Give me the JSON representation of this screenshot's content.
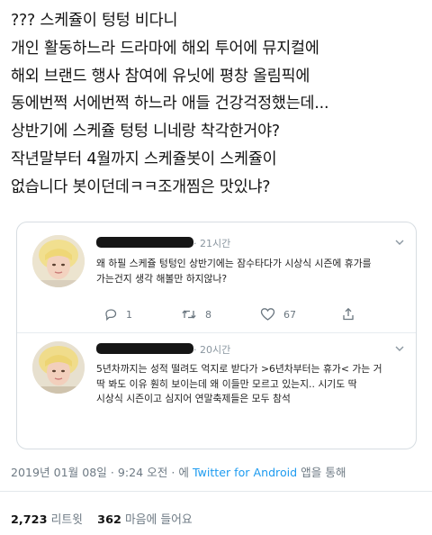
{
  "tweet": {
    "lines": [
      "??? 스케쥴이 텅텅 비다니",
      "개인 활동하느라 드라마에 해외 투어에 뮤지컬에",
      "해외 브랜드 행사 참여에 유닛에 평창 올림픽에",
      "동에번쩍 서에번쩍 하느라 애들 건강걱정했는데...",
      "상반기에 스케쥴 텅텅 니네랑 착각한거야?",
      "작년말부터 4월까지 스케쥴봇이 스케쥴이",
      "없습니다 봇이던데ㅋㅋ조개찜은 맛있냐?"
    ]
  },
  "replies": [
    {
      "time": "· 21시간",
      "lines": [
        "왜 하필 스케쥴 텅텅인 상반기에는 잠수타다가 시상식 시즌에 휴가를",
        "가는건지 생각 해볼만 하지않나?"
      ],
      "counts": {
        "reply": "1",
        "retweet": "8",
        "like": "67"
      }
    },
    {
      "time": "· 20시간",
      "lines": [
        "5년차까지는 성적 떨려도 억지로 받다가 >6년차부터는 휴가< 가는 거",
        "딱 봐도 이유 훤히 보이는데 왜 이들만 모르고 있는지.. 시기도 딱",
        "시상식 시즌이고 심지어 연말축제들은 모두 참석"
      ]
    }
  ],
  "meta": {
    "datetime": "2019년 01월 08일 · 9:24 오전 · 에 ",
    "source": "Twitter for Android",
    "via": " 앱을 통해"
  },
  "stats": {
    "retweets": "2,723",
    "retweets_label": "리트윗",
    "likes": "362",
    "likes_label": "마음에 들어요"
  },
  "colors": {
    "link": "#1d9bf0",
    "muted": "#6e7a84",
    "border": "#d7dde2"
  },
  "icons": [
    "reply-icon",
    "retweet-icon",
    "heart-icon",
    "share-icon",
    "chevron-down-icon"
  ]
}
